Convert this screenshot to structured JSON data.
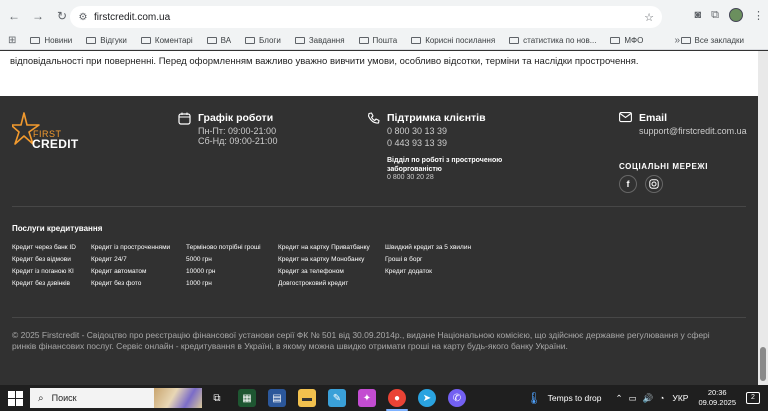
{
  "browser": {
    "url": "firstcredit.com.ua",
    "bookmarks": [
      "Новини",
      "Відгуки",
      "Коментарі",
      "ВА",
      "Блоги",
      "Завдання",
      "Пошта",
      "Корисні посилання",
      "статистика по нов...",
      "МФО"
    ],
    "all_bookmarks_label": "Все закладки"
  },
  "page": {
    "intro_text": "відповідальності при поверненні. Перед оформленням важливо уважно вивчити умови, особливо відсотки, терміни та наслідки прострочення."
  },
  "footer": {
    "logo_first": "FIRST",
    "logo_credit": "CREDIT",
    "schedule": {
      "title": "Графік роботи",
      "line1": "Пн-Пт: 09:00-21:00",
      "line2": "Сб-Нд: 09:00-21:00"
    },
    "support": {
      "title": "Підтримка клієнтів",
      "phone1": "0 800 30 13 39",
      "phone2": "0 443 93 13 39",
      "overdue_title": "Відділ по роботі з простроченою заборгованістю",
      "overdue_phone": "0 800 30 20 28"
    },
    "email": {
      "title": "Email",
      "address": "support@firstcredit.com.ua"
    },
    "social_title": "СОЦІАЛЬНІ МЕРЕЖІ",
    "services_title": "Послуги кредитування",
    "services_columns": [
      [
        "Кредит через банк ID",
        "Кредит без відмови",
        "Кредит із поганою КІ",
        "Кредит без дзвінків"
      ],
      [
        "Кредит із простроченнями",
        "Кредит 24/7",
        "Кредит автоматом",
        "Кредит без фото"
      ],
      [
        "Терміново потрібні гроші",
        "5000 грн",
        "10000 грн",
        "1000 грн"
      ],
      [
        "Кредит на картку Приватбанку",
        "Кредит на картку Монобанку",
        "Кредит за телефоном",
        "Довгостроковий кредит"
      ],
      [
        "Швидкий кредит за 5 хвилин",
        "Гроші в борг",
        "Кредит додаток"
      ]
    ],
    "copyright": "© 2025 Firstcredit - Свідоцтво про реєстрацію фінансової установи серії ФК № 501 від 30.09.2014р., видане Національною комісією, що здійснює державне регулювання у сфері ринків фінансових послуг. Сервіс онлайн - кредитування в Україні, в якому можна швидко отримати гроші на карту будь-якого банку України."
  },
  "taskbar": {
    "search_placeholder": "Поиск",
    "temps_label": "Temps to drop",
    "language": "УКР",
    "time": "20:36",
    "date": "09.09.2025",
    "notif_count": "2"
  }
}
